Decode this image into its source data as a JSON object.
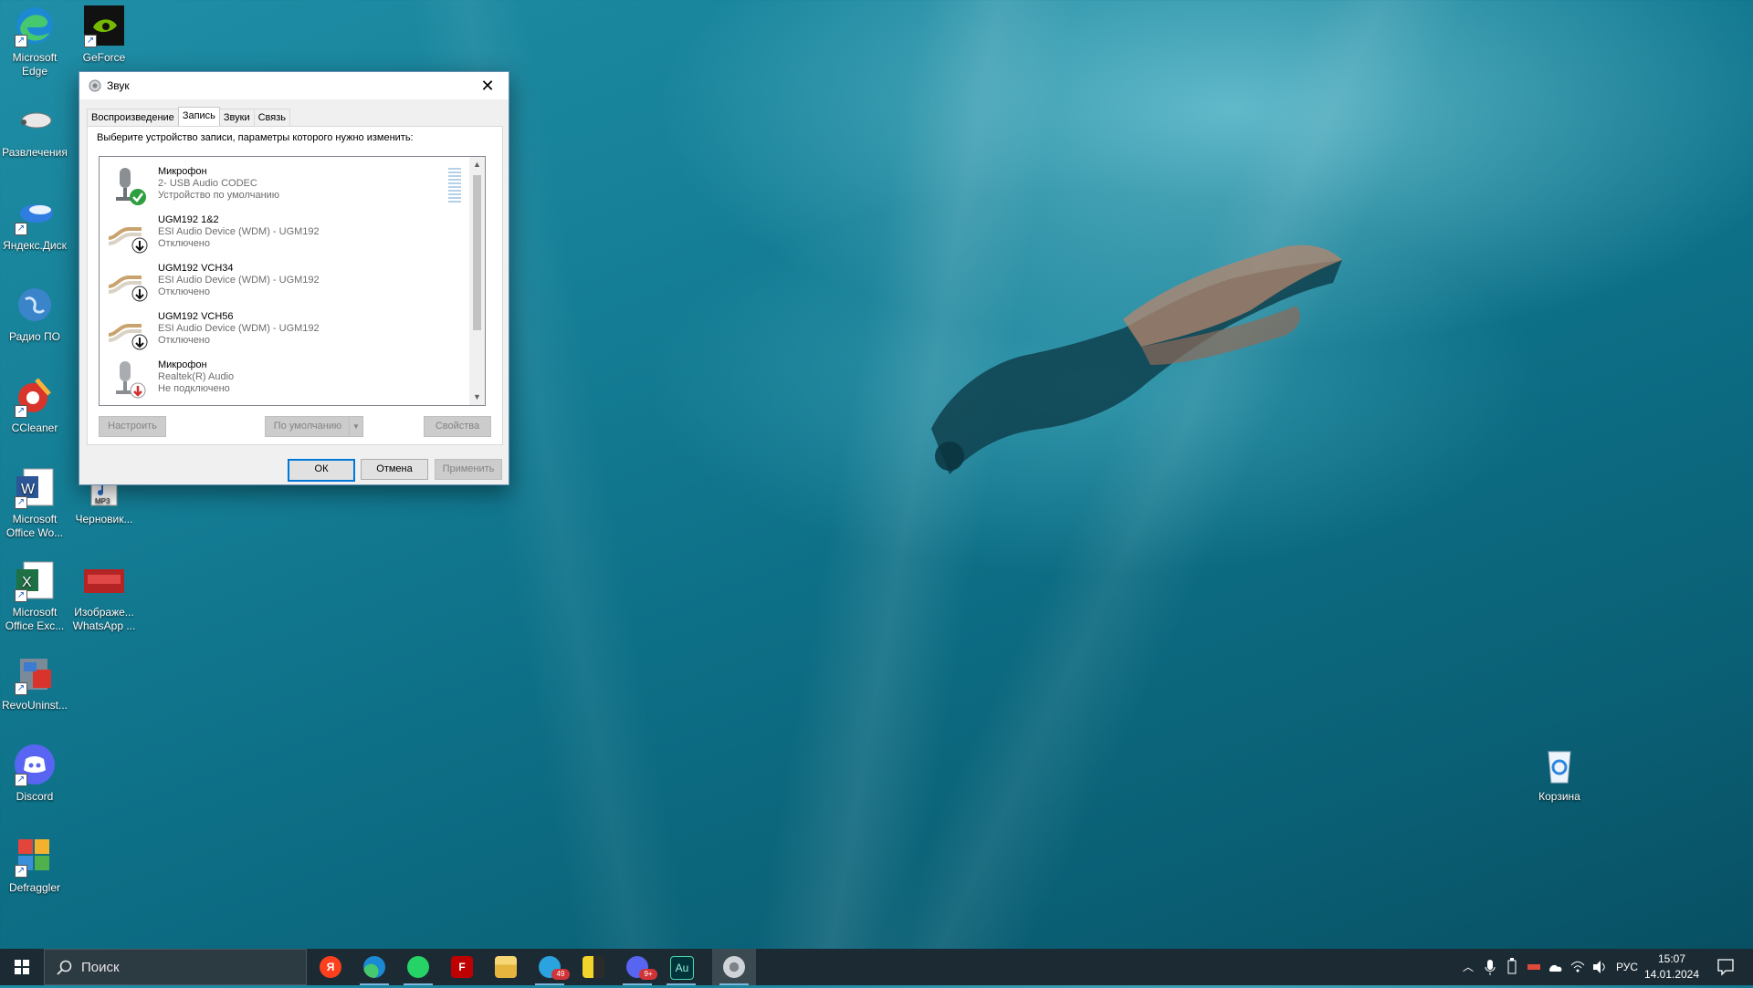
{
  "desktop": {
    "icons": [
      {
        "label": "Microsoft Edge"
      },
      {
        "label": "GeForce"
      },
      {
        "label": "Развлечения"
      },
      {
        "label": "Яндекс.Диск"
      },
      {
        "label": "Радио ПО"
      },
      {
        "label": "CCleaner"
      },
      {
        "label": "Microsoft Office Wo..."
      },
      {
        "label": "Черновик..."
      },
      {
        "label": "Microsoft Office Exc..."
      },
      {
        "label": "Изображе... WhatsApp ..."
      },
      {
        "label": "RevoUninst..."
      },
      {
        "label": "Discord"
      },
      {
        "label": "Defraggler"
      },
      {
        "label": "Корзина"
      }
    ]
  },
  "dialog": {
    "title": "Звук",
    "tabs": [
      {
        "label": "Воспроизведение"
      },
      {
        "label": "Запись",
        "active": true
      },
      {
        "label": "Звуки"
      },
      {
        "label": "Связь"
      }
    ],
    "instruction": "Выберите устройство записи, параметры которого нужно изменить:",
    "devices": [
      {
        "name": "Микрофон",
        "driver": "2- USB Audio CODEC",
        "status": "Устройство по умолчанию"
      },
      {
        "name": "UGM192 1&2",
        "driver": "ESI Audio Device (WDM) - UGM192",
        "status": "Отключено"
      },
      {
        "name": "UGM192 VCH34",
        "driver": "ESI Audio Device (WDM) - UGM192",
        "status": "Отключено"
      },
      {
        "name": "UGM192 VCH56",
        "driver": "ESI Audio Device (WDM) - UGM192",
        "status": "Отключено"
      },
      {
        "name": "Микрофон",
        "driver": "Realtek(R) Audio",
        "status": "Не подключено"
      }
    ],
    "buttons": {
      "configure": "Настроить",
      "set_default": "По умолчанию",
      "properties": "Свойства",
      "ok": "ОК",
      "cancel": "Отмена",
      "apply": "Применить"
    }
  },
  "taskbar": {
    "search_placeholder": "Поиск",
    "apps": [
      {
        "name": "yandex-browser",
        "icon": "yandex-icon"
      },
      {
        "name": "edge",
        "icon": "edge-icon"
      },
      {
        "name": "whatsapp",
        "icon": "whatsapp-icon"
      },
      {
        "name": "filezilla",
        "icon": "filezilla-icon"
      },
      {
        "name": "file-explorer",
        "icon": "folder-icon"
      },
      {
        "name": "telegram",
        "icon": "telegram-icon",
        "badge": "49"
      },
      {
        "name": "winrar",
        "icon": "winrar-icon"
      },
      {
        "name": "discord",
        "icon": "discord-icon",
        "badge": "9+"
      },
      {
        "name": "audition",
        "icon": "audition-icon",
        "text": "Au"
      },
      {
        "name": "sound-settings",
        "icon": "speaker-settings-icon",
        "active": true
      }
    ],
    "language": "РУС",
    "time": "15:07",
    "date": "14.01.2024"
  },
  "colors": {
    "taskbar": "#1c2b33",
    "accent": "#0078d7",
    "default_check": "#2e9e3f",
    "disconnected": "#d32f2f"
  }
}
